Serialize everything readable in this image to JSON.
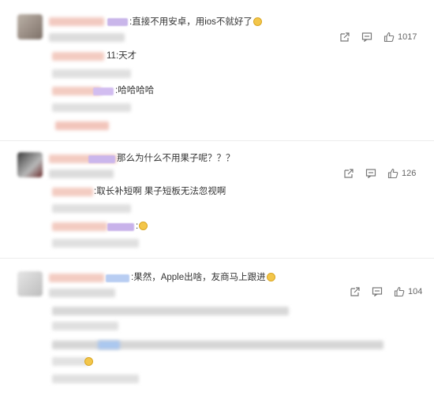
{
  "comments": [
    {
      "text": ":直接不用安卓，用ios不就好了",
      "likes": "1017",
      "replies": [
        "11:天才",
        ":哈哈哈哈"
      ]
    },
    {
      "text": "那么为什么不用果子呢？？？",
      "likes": "126",
      "replies": [
        ":取长补短啊  果子短板无法忽视啊",
        ":"
      ]
    },
    {
      "text": ":果然，Apple出啥，友商马上跟进",
      "likes": "104",
      "replies": []
    }
  ],
  "icons": {
    "share": "share-icon",
    "comment": "comment-icon",
    "like": "thumbs-up-icon",
    "emoji": "smiley-emoji-icon"
  },
  "colors": {
    "text": "#333333",
    "meta": "#666666",
    "divider": "#ececec"
  }
}
